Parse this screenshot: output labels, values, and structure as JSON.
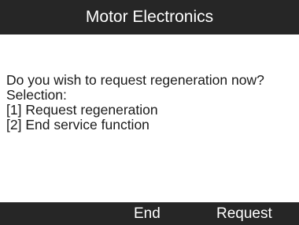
{
  "header": {
    "title": "Motor Electronics"
  },
  "prompt": {
    "question": "Do you wish to request regeneration now?",
    "selection_label": "Selection:",
    "options": [
      "[1]  Request regeneration",
      "[2]  End service function"
    ]
  },
  "softkeys": {
    "left": "",
    "middle": "End",
    "right": "Request"
  }
}
